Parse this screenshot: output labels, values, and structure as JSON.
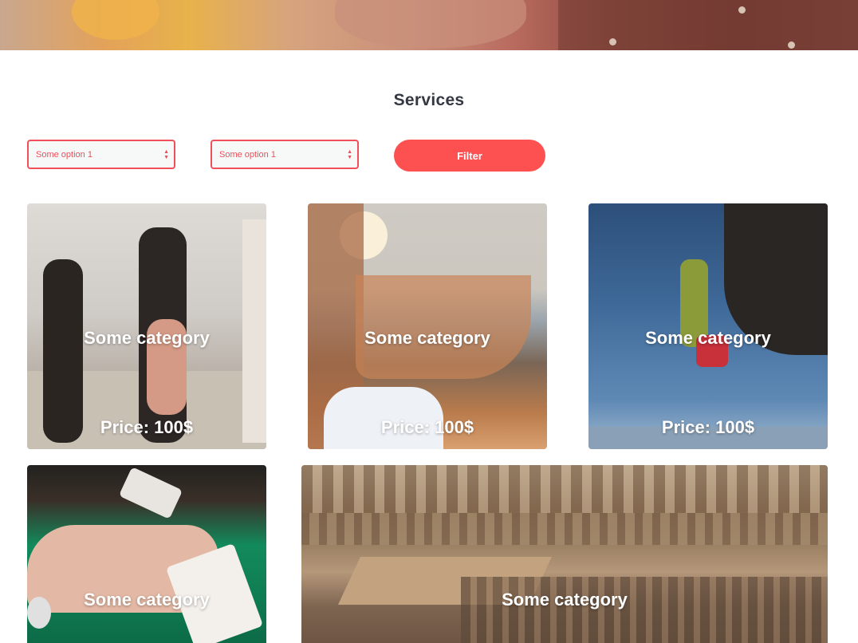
{
  "header": {
    "section_title": "Services"
  },
  "filters": {
    "select1_value": "Some option 1",
    "select2_value": "Some option 1",
    "filter_label": "Filter"
  },
  "cards": [
    {
      "category": "Some category",
      "price": "Price: 100$",
      "image": "runners-photo"
    },
    {
      "category": "Some category",
      "price": "Price: 100$",
      "image": "yoga-beach-photo"
    },
    {
      "category": "Some category",
      "price": "Price: 100$",
      "image": "rock-climber-photo"
    },
    {
      "category": "Some category",
      "image": "poker-cards-photo"
    },
    {
      "category": "Some category",
      "image": "colosseum-photo"
    }
  ],
  "colors": {
    "accent": "#fd5050",
    "title": "#333842"
  }
}
